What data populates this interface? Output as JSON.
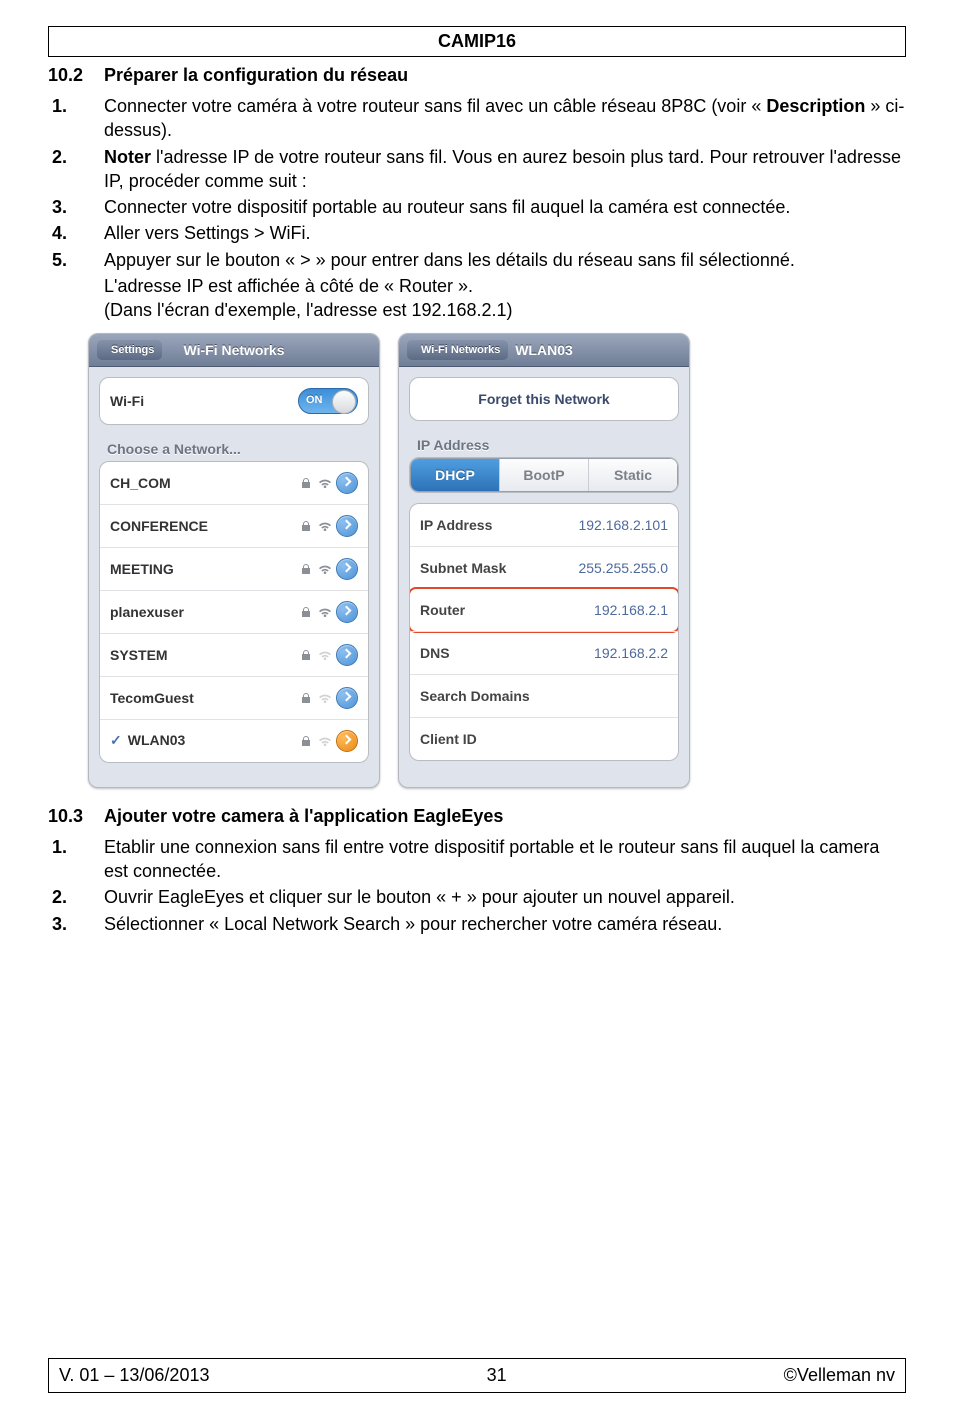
{
  "header": {
    "title": "CAMIP16"
  },
  "section102": {
    "num": "10.2",
    "title": "Préparer la configuration du réseau",
    "steps": [
      {
        "n": "1.",
        "html": "Connecter votre caméra à votre routeur sans fil avec un câble réseau 8P8C (voir « <b>Description</b> » ci-dessus)."
      },
      {
        "n": "2.",
        "html": "<b>Noter</b> l'adresse IP de votre routeur sans fil. Vous en aurez besoin plus tard. Pour retrouver l'adresse IP, procéder comme suit :"
      },
      {
        "n": "3.",
        "html": "Connecter votre dispositif portable au routeur sans fil auquel la caméra est connectée."
      },
      {
        "n": "4.",
        "html": "Aller vers Settings > WiFi."
      },
      {
        "n": "5.",
        "html": "Appuyer sur le bouton « > » pour entrer dans les détails du réseau sans fil sélectionné."
      }
    ],
    "note1": "L'adresse IP est affichée à côté de « Router ».",
    "note2": "(Dans l'écran d'exemple, l'adresse est 192.168.2.1)"
  },
  "wifi_panel": {
    "back": "Settings",
    "title": "Wi-Fi Networks",
    "wifi_label": "Wi-Fi",
    "toggle": "ON",
    "choose_label": "Choose a Network...",
    "networks": [
      {
        "name": "CH_COM",
        "locked": true,
        "strength": 3
      },
      {
        "name": "CONFERENCE",
        "locked": true,
        "strength": 3
      },
      {
        "name": "MEETING",
        "locked": true,
        "strength": 3
      },
      {
        "name": "planexuser",
        "locked": true,
        "strength": 3
      },
      {
        "name": "SYSTEM",
        "locked": true,
        "strength": 2
      },
      {
        "name": "TecomGuest",
        "locked": true,
        "strength": 2
      },
      {
        "name": "WLAN03",
        "locked": true,
        "strength": 2,
        "selected": true,
        "active": true
      }
    ]
  },
  "detail_panel": {
    "back": "Wi-Fi Networks",
    "title": "WLAN03",
    "forget": "Forget this Network",
    "ip_section": "IP Address",
    "tabs": {
      "dhcp": "DHCP",
      "bootp": "BootP",
      "static": "Static",
      "selected": "dhcp"
    },
    "rows": {
      "ip_label": "IP Address",
      "ip_value": "192.168.2.101",
      "mask_label": "Subnet Mask",
      "mask_value": "255.255.255.0",
      "router_label": "Router",
      "router_value": "192.168.2.1",
      "dns_label": "DNS",
      "dns_value": "192.168.2.2",
      "search_label": "Search Domains",
      "search_value": "",
      "client_label": "Client ID",
      "client_value": ""
    }
  },
  "section103": {
    "num": "10.3",
    "title": "Ajouter votre camera à l'application EagleEyes",
    "steps": [
      {
        "n": "1.",
        "html": "Etablir une connexion sans fil entre votre dispositif portable et le routeur sans fil auquel la camera est connectée."
      },
      {
        "n": "2.",
        "html": "Ouvrir EagleEyes et cliquer sur le bouton « + » pour ajouter un nouvel appareil."
      },
      {
        "n": "3.",
        "html": "Sélectionner « Local Network Search » pour rechercher votre caméra réseau."
      }
    ]
  },
  "footer": {
    "left": "V. 01 – 13/06/2013",
    "center": "31",
    "right": "©Velleman nv"
  }
}
